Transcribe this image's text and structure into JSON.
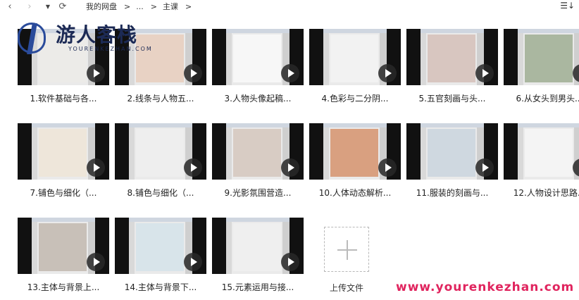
{
  "nav": {
    "back_icon": "‹",
    "forward_icon": "›",
    "dropdown_icon": "▼",
    "refresh_icon": "⟳",
    "sort_icon": "☰↓"
  },
  "breadcrumb": {
    "items": [
      "我的网盘",
      "...",
      "主课"
    ],
    "separator": ">"
  },
  "watermark": {
    "logo_text": "游人客栈",
    "logo_sub": "YOURENKEZHAN.COM",
    "url": "www.yourenkezhan.com",
    "url_color": "#e0245e"
  },
  "files": [
    {
      "name": "1.软件基础与各...",
      "thumb": "#ecebe8"
    },
    {
      "name": "2.线条与人物五...",
      "thumb": "#e8d2c4"
    },
    {
      "name": "3.人物头像起稿...",
      "thumb": "#f7f7f7"
    },
    {
      "name": "4.色彩与二分阴...",
      "thumb": "#f2f2f2"
    },
    {
      "name": "5.五官刻画与头...",
      "thumb": "#d8c6c0"
    },
    {
      "name": "6.从女头到男头...",
      "thumb": "#aab7a0"
    },
    {
      "name": "7.铺色与细化（...",
      "thumb": "#eee6da"
    },
    {
      "name": "8.铺色与细化（...",
      "thumb": "#eeeeee"
    },
    {
      "name": "9.光影氛围营造...",
      "thumb": "#d8ccc4"
    },
    {
      "name": "10.人体动态解析...",
      "thumb": "#d9a080"
    },
    {
      "name": "11.服装的刻画与...",
      "thumb": "#cfd8e0"
    },
    {
      "name": "12.人物设计思路...",
      "thumb": "#f4f4f4"
    },
    {
      "name": "13.主体与背景上...",
      "thumb": "#c8c0b8"
    },
    {
      "name": "14.主体与背景下...",
      "thumb": "#d8e4ea"
    },
    {
      "name": "15.元素运用与接...",
      "thumb": "#efefef"
    }
  ],
  "upload": {
    "label": "上传文件"
  }
}
